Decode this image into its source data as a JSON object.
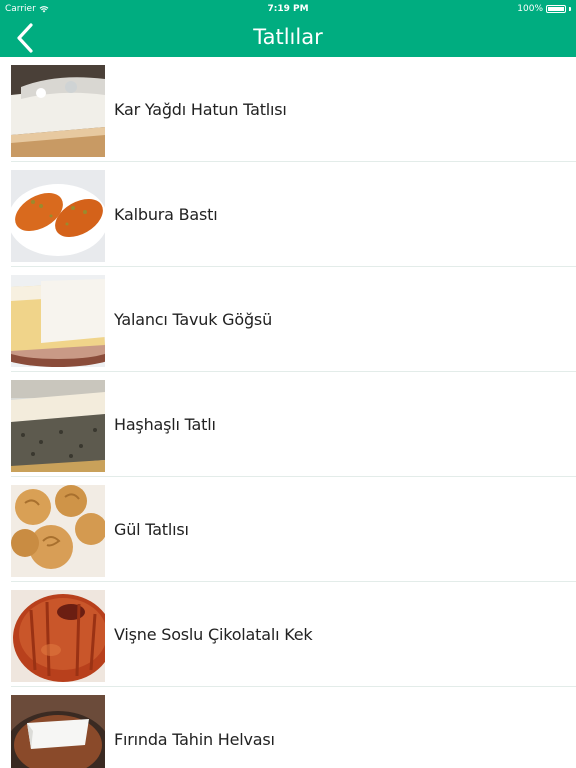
{
  "status_bar": {
    "carrier": "Carrier",
    "time": "7:19 PM",
    "battery": "100%"
  },
  "nav": {
    "title": "Tatlılar",
    "back_icon": "chevron-left-icon"
  },
  "colors": {
    "accent": "#00ad80",
    "text": "#222222",
    "divider": "#e3ece9"
  },
  "items": [
    {
      "label": "Kar Yağdı Hatun Tatlısı",
      "image": "coconut-dessert-photo"
    },
    {
      "label": "Kalbura Bastı",
      "image": "kalbura-basti-photo"
    },
    {
      "label": "Yalancı Tavuk Göğsü",
      "image": "milk-pudding-photo"
    },
    {
      "label": "Haşhaşlı Tatlı",
      "image": "poppy-seed-cake-photo"
    },
    {
      "label": "Gül Tatlısı",
      "image": "rose-dessert-photo"
    },
    {
      "label": "Vişne Soslu Çikolatalı Kek",
      "image": "bundt-cake-photo"
    },
    {
      "label": "Fırında Tahin Helvası",
      "image": "tahini-halva-photo"
    }
  ]
}
